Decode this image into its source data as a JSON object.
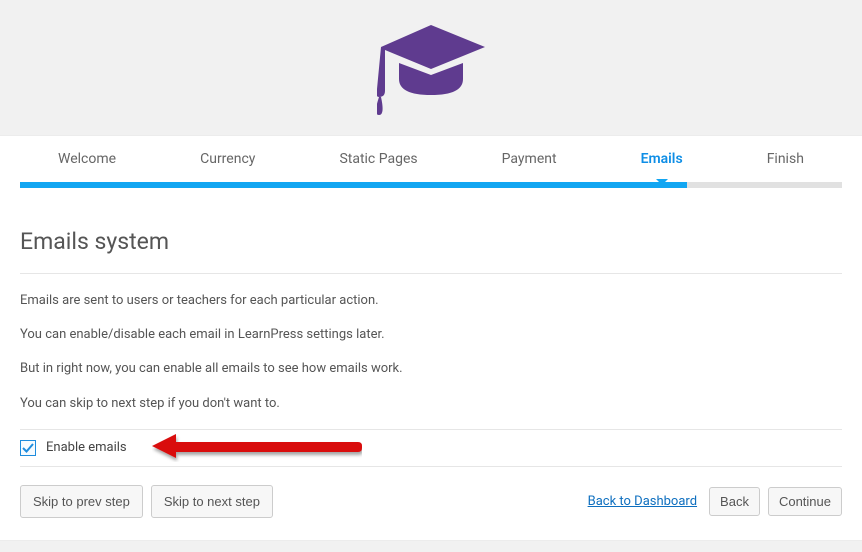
{
  "tabs": [
    "Welcome",
    "Currency",
    "Static Pages",
    "Payment",
    "Emails",
    "Finish"
  ],
  "activeTabIndex": 4,
  "heading": "Emails system",
  "paragraphs": [
    "Emails are sent to users or teachers for each particular action.",
    "You can enable/disable each email in LearnPress settings later.",
    "But in right now, you can enable all emails to see how emails work.",
    "You can skip to next step if you don't want to."
  ],
  "checkbox": {
    "label": "Enable emails",
    "checked": true
  },
  "footer": {
    "prev": "Skip to prev step",
    "next": "Skip to next step",
    "dashboard": "Back to Dashboard",
    "back": "Back",
    "continue": "Continue"
  }
}
